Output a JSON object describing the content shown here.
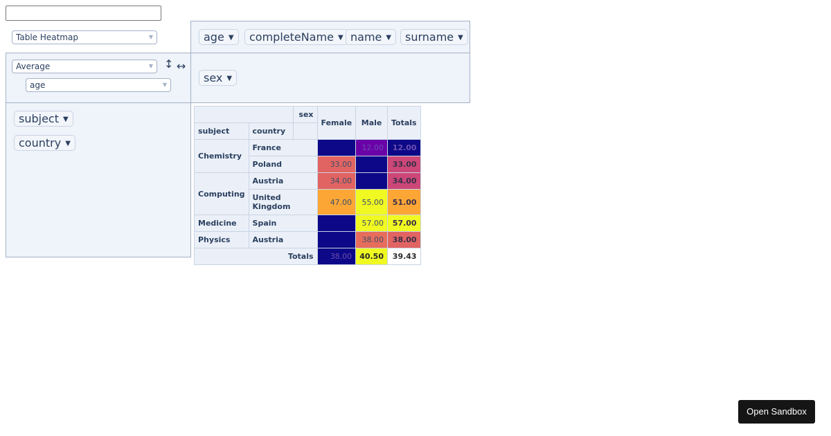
{
  "filter_input": {
    "value": "",
    "placeholder": ""
  },
  "renderer": {
    "selected": "Table Heatmap"
  },
  "aggregator": {
    "selected": "Average",
    "attribute": "age"
  },
  "sort_icons": {
    "rows": "↕",
    "cols": "↔"
  },
  "unused_attrs": [
    "age",
    "completeName",
    "name",
    "surname"
  ],
  "col_attrs": [
    "sex"
  ],
  "row_attrs": [
    "subject",
    "country"
  ],
  "table": {
    "col_header": "sex",
    "row_headers": [
      "subject",
      "country"
    ],
    "columns": [
      "Female",
      "Male",
      "Totals"
    ],
    "rows": [
      {
        "subject": "Chemistry",
        "country": "France",
        "values": [
          "",
          "12.00",
          "12.00"
        ]
      },
      {
        "subject": "",
        "country": "Poland",
        "values": [
          "33.00",
          "",
          "33.00"
        ]
      },
      {
        "subject": "Computing",
        "country": "Austria",
        "values": [
          "34.00",
          "",
          "34.00"
        ]
      },
      {
        "subject": "",
        "country": "United Kingdom",
        "values": [
          "47.00",
          "55.00",
          "51.00"
        ]
      },
      {
        "subject": "Medicine",
        "country": "Spain",
        "values": [
          "",
          "57.00",
          "57.00"
        ]
      },
      {
        "subject": "Physics",
        "country": "Austria",
        "values": [
          "",
          "38.00",
          "38.00"
        ]
      }
    ],
    "totals_label": "Totals",
    "totals": [
      "38.00",
      "40.50",
      "39.43"
    ],
    "cell_colors": [
      [
        "#0d0887",
        "#6a00a8",
        "#0d0887"
      ],
      [
        "#e16462",
        "#0d0887",
        "#cc4778"
      ],
      [
        "#e16462",
        "#0d0887",
        "#cc4778"
      ],
      [
        "#fca636",
        "#f0f921",
        "#fca636"
      ],
      [
        "#0d0887",
        "#f0f921",
        "#f0f921"
      ],
      [
        "#0d0887",
        "#e66c5c",
        "#e16462"
      ]
    ],
    "totals_colors": [
      "#0d0887",
      "#f0f921",
      "#ffffff"
    ]
  },
  "sandbox_button": "Open Sandbox"
}
